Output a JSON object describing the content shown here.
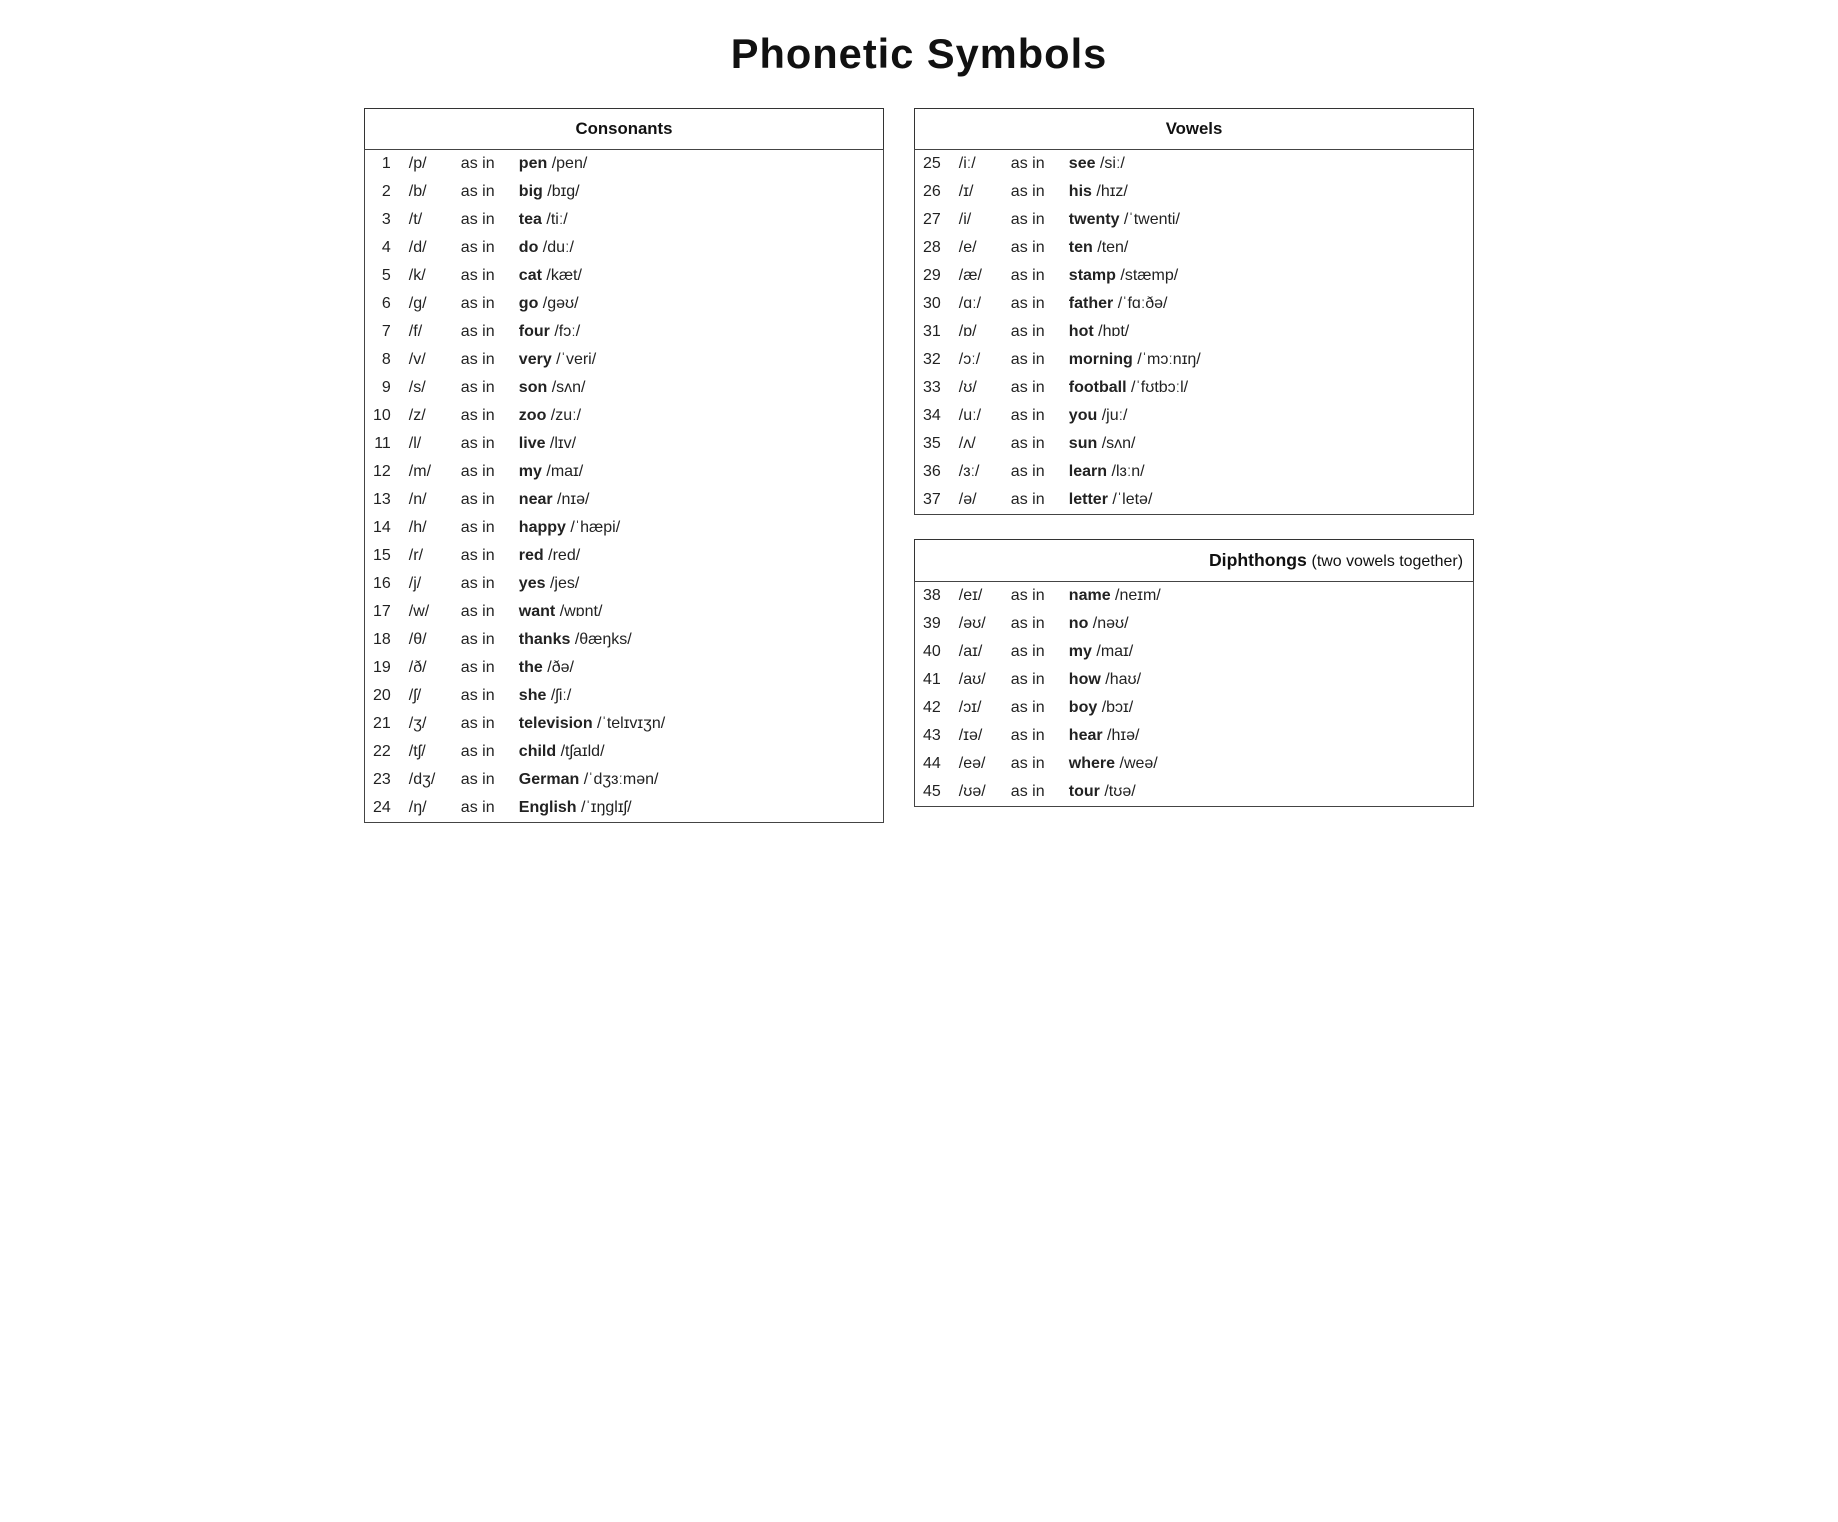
{
  "title": "Phonetic Symbols",
  "consonants": {
    "header": "Consonants",
    "rows": [
      {
        "num": "1",
        "sym": "/p/",
        "asin": "as in",
        "word": "pen",
        "ipa": "/pen/"
      },
      {
        "num": "2",
        "sym": "/b/",
        "asin": "as in",
        "word": "big",
        "ipa": "/bɪg/"
      },
      {
        "num": "3",
        "sym": "/t/",
        "asin": "as in",
        "word": "tea",
        "ipa": "/tiː/"
      },
      {
        "num": "4",
        "sym": "/d/",
        "asin": "as in",
        "word": "do",
        "ipa": "/duː/"
      },
      {
        "num": "5",
        "sym": "/k/",
        "asin": "as in",
        "word": "cat",
        "ipa": "/kæt/"
      },
      {
        "num": "6",
        "sym": "/g/",
        "asin": "as in",
        "word": "go",
        "ipa": "/gəʊ/"
      },
      {
        "num": "7",
        "sym": "/f/",
        "asin": "as in",
        "word": "four",
        "ipa": "/fɔː/"
      },
      {
        "num": "8",
        "sym": "/v/",
        "asin": "as in",
        "word": "very",
        "ipa": "/ˈveri/"
      },
      {
        "num": "9",
        "sym": "/s/",
        "asin": "as in",
        "word": "son",
        "ipa": "/sʌn/"
      },
      {
        "num": "10",
        "sym": "/z/",
        "asin": "as in",
        "word": "zoo",
        "ipa": "/zuː/"
      },
      {
        "num": "11",
        "sym": "/l/",
        "asin": "as in",
        "word": "live",
        "ipa": "/lɪv/"
      },
      {
        "num": "12",
        "sym": "/m/",
        "asin": "as in",
        "word": "my",
        "ipa": "/maɪ/"
      },
      {
        "num": "13",
        "sym": "/n/",
        "asin": "as in",
        "word": "near",
        "ipa": "/nɪə/"
      },
      {
        "num": "14",
        "sym": "/h/",
        "asin": "as in",
        "word": "happy",
        "ipa": "/ˈhæpi/"
      },
      {
        "num": "15",
        "sym": "/r/",
        "asin": "as in",
        "word": "red",
        "ipa": "/red/"
      },
      {
        "num": "16",
        "sym": "/j/",
        "asin": "as in",
        "word": "yes",
        "ipa": "/jes/"
      },
      {
        "num": "17",
        "sym": "/w/",
        "asin": "as in",
        "word": "want",
        "ipa": "/wɒnt/"
      },
      {
        "num": "18",
        "sym": "/θ/",
        "asin": "as in",
        "word": "thanks",
        "ipa": "/θæŋks/"
      },
      {
        "num": "19",
        "sym": "/ð/",
        "asin": "as in",
        "word": "the",
        "ipa": "/ðə/"
      },
      {
        "num": "20",
        "sym": "/ʃ/",
        "asin": "as in",
        "word": "she",
        "ipa": "/ʃiː/"
      },
      {
        "num": "21",
        "sym": "/ʒ/",
        "asin": "as in",
        "word": "television",
        "ipa": "/ˈtelɪvɪʒn/"
      },
      {
        "num": "22",
        "sym": "/tʃ/",
        "asin": "as in",
        "word": "child",
        "ipa": "/tʃaɪld/"
      },
      {
        "num": "23",
        "sym": "/dʒ/",
        "asin": "as in",
        "word": "German",
        "ipa": "/ˈdʒɜːmən/"
      },
      {
        "num": "24",
        "sym": "/ŋ/",
        "asin": "as in",
        "word": "English",
        "ipa": "/ˈɪŋglɪʃ/"
      }
    ]
  },
  "vowels": {
    "header": "Vowels",
    "rows": [
      {
        "num": "25",
        "sym": "/iː/",
        "asin": "as in",
        "word": "see",
        "ipa": "/siː/"
      },
      {
        "num": "26",
        "sym": "/ɪ/",
        "asin": "as in",
        "word": "his",
        "ipa": "/hɪz/"
      },
      {
        "num": "27",
        "sym": "/i/",
        "asin": "as in",
        "word": "twenty",
        "ipa": "/ˈtwenti/"
      },
      {
        "num": "28",
        "sym": "/e/",
        "asin": "as in",
        "word": "ten",
        "ipa": "/ten/"
      },
      {
        "num": "29",
        "sym": "/æ/",
        "asin": "as in",
        "word": "stamp",
        "ipa": "/stæmp/"
      },
      {
        "num": "30",
        "sym": "/ɑː/",
        "asin": "as in",
        "word": "father",
        "ipa": "/ˈfɑːðə/"
      },
      {
        "num": "31",
        "sym": "/ɒ/",
        "asin": "as in",
        "word": "hot",
        "ipa": "/hɒt/"
      },
      {
        "num": "32",
        "sym": "/ɔː/",
        "asin": "as in",
        "word": "morning",
        "ipa": "/ˈmɔːnɪŋ/"
      },
      {
        "num": "33",
        "sym": "/ʊ/",
        "asin": "as in",
        "word": "football",
        "ipa": "/ˈfʊtbɔːl/"
      },
      {
        "num": "34",
        "sym": "/uː/",
        "asin": "as in",
        "word": "you",
        "ipa": "/juː/"
      },
      {
        "num": "35",
        "sym": "/ʌ/",
        "asin": "as in",
        "word": "sun",
        "ipa": "/sʌn/"
      },
      {
        "num": "36",
        "sym": "/ɜː/",
        "asin": "as in",
        "word": "learn",
        "ipa": "/lɜːn/"
      },
      {
        "num": "37",
        "sym": "/ə/",
        "asin": "as in",
        "word": "letter",
        "ipa": "/ˈletə/"
      }
    ]
  },
  "diphthongs": {
    "header": "Diphthongs",
    "subtitle": "(two vowels together)",
    "rows": [
      {
        "num": "38",
        "sym": "/eɪ/",
        "asin": "as in",
        "word": "name",
        "ipa": "/neɪm/"
      },
      {
        "num": "39",
        "sym": "/əʊ/",
        "asin": "as in",
        "word": "no",
        "ipa": "/nəʊ/"
      },
      {
        "num": "40",
        "sym": "/aɪ/",
        "asin": "as in",
        "word": "my",
        "ipa": "/maɪ/"
      },
      {
        "num": "41",
        "sym": "/aʊ/",
        "asin": "as in",
        "word": "how",
        "ipa": "/haʊ/"
      },
      {
        "num": "42",
        "sym": "/ɔɪ/",
        "asin": "as in",
        "word": "boy",
        "ipa": "/bɔɪ/"
      },
      {
        "num": "43",
        "sym": "/ɪə/",
        "asin": "as in",
        "word": "hear",
        "ipa": "/hɪə/"
      },
      {
        "num": "44",
        "sym": "/eə/",
        "asin": "as in",
        "word": "where",
        "ipa": "/weə/"
      },
      {
        "num": "45",
        "sym": "/ʊə/",
        "asin": "as in",
        "word": "tour",
        "ipa": "/tʊə/"
      }
    ]
  }
}
